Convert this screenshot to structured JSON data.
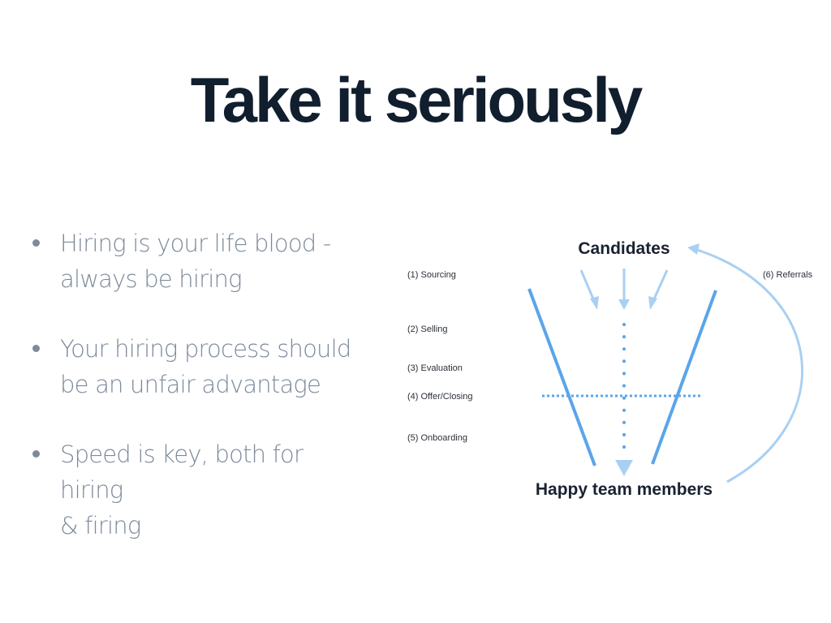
{
  "slide": {
    "title": "Take it seriously",
    "bullets": [
      {
        "line1": "Hiring is your life blood -",
        "line2": "always be hiring"
      },
      {
        "line1": "Your hiring process should",
        "line2": "be an unfair advantage"
      },
      {
        "line1": "Speed is key, both for hiring",
        "line2": "& firing"
      }
    ]
  },
  "diagram": {
    "top_label": "Candidates",
    "bottom_label": "Happy team members",
    "stages": [
      "(1) Sourcing",
      "(2) Selling",
      "(3) Evaluation",
      "(4) Offer/Closing",
      "(5) Onboarding"
    ],
    "loop_label": "(6) Referrals",
    "colors": {
      "funnel": "#5aa5ea",
      "arrows": "#a9d0f3",
      "title": "#111e2e",
      "bullet_text": "#7d8a9b"
    }
  }
}
